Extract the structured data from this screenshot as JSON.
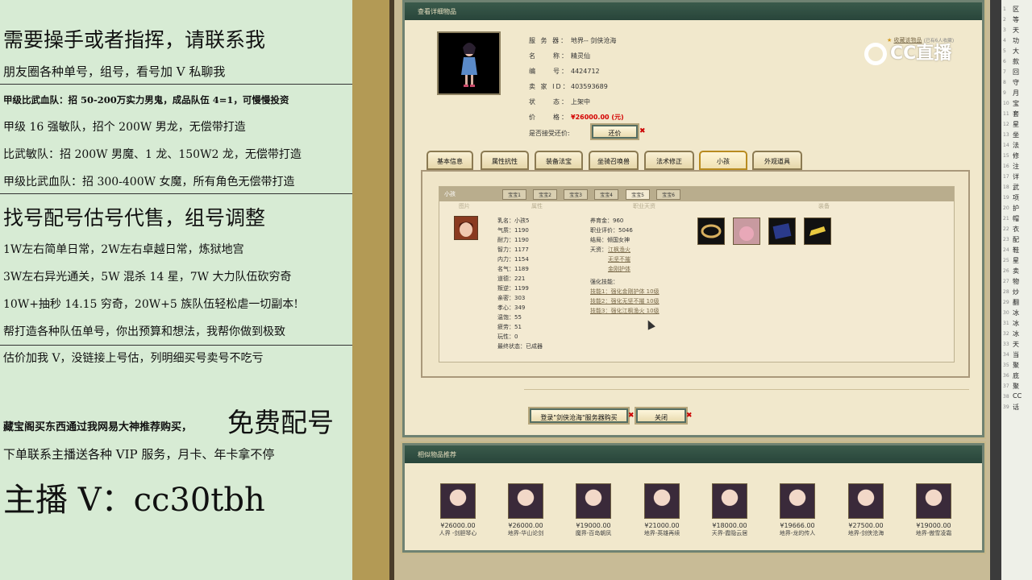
{
  "overlay": {
    "line1": "需要操手或者指挥，请联系我",
    "line2": "朋友圈各种单号，组号，看号加 V 私聊我",
    "line3": "甲级比武血队：招 50-200万实力男鬼，成品队伍 4=1，可慢慢投资",
    "line4": "甲级 16 强敏队，招个 200W 男龙，无偿带打造",
    "line5": "比武敏队：招 200W 男魔、1 龙、150W2 龙，无偿带打造",
    "line6": "甲级比武血队：招 300-400W 女魔，所有角色无偿带打造",
    "line7": "找号配号估号代售，组号调整",
    "line8": "1W左右简单日常，2W左右卓越日常，炼狱地宫",
    "line9": "3W左右异光通关，5W 混杀 14 星，7W 大力队伍砍穷奇",
    "line10": "10W+抽秒 14.15 穷奇，20W+5 族队伍轻松虐一切副本!",
    "line11": "帮打造各种队伍单号，你出预算和想法，我帮你做到极致",
    "line12": "估价加我 V，没链接上号估，列明细买号卖号不吃亏",
    "line13a": "藏宝阁买东西通过我网易大神推荐购买，",
    "line13b": "免费配号",
    "line14": "下单联系主播送各种 VIP 服务，月卡、年卡拿不停",
    "line15": "主播 V：cc30tbh"
  },
  "logo": "CC直播",
  "panel1": {
    "title": "查看详细物品",
    "favorite": "收藏该物品",
    "favorite_count": "(已有6人收藏)",
    "fields": [
      {
        "k": "服 务 器：",
        "v": "地界-- 剑侠沧海"
      },
      {
        "k": "名　　称：",
        "v": "精灵仙"
      },
      {
        "k": "编　　号：",
        "v": "4424712"
      },
      {
        "k": "卖 家 ID：",
        "v": "403593689"
      },
      {
        "k": "状　　态：",
        "v": "上架中"
      },
      {
        "k": "价　　格：",
        "v": "¥26000.00 (元)"
      }
    ],
    "bargain_label": "是否接受还价:",
    "bargain_btn": "还价",
    "tabs": [
      "基本信息",
      "属性抗性",
      "装备法宝",
      "坐骑召唤兽",
      "法术修正",
      "小孩",
      "外观道具"
    ],
    "child": {
      "header": "小孩",
      "subtabs": [
        "宝宝1",
        "宝宝2",
        "宝宝3",
        "宝宝4",
        "宝宝5",
        "宝宝6"
      ],
      "col_pic": "图片",
      "col_attr": "属性",
      "col_skill": "职业天资",
      "col_equip": "装备",
      "attrs": [
        "乳名：小孩5",
        "气质：1190",
        "耐力：1190",
        "智力：1177",
        "内力：1154",
        "名气：1189",
        "道德：221",
        "叛逆：1199",
        "亲密：303",
        "孝心：349",
        "温饱：55",
        "疲劳：51",
        "玩性：0",
        "最终状态：已成器"
      ],
      "skills_top": [
        "养育金：960",
        "职业评价：5046",
        "结局：倾国女神"
      ],
      "talent_label": "天资：",
      "talents": [
        "江枫渔火",
        "无坚不摧",
        "金刚护体"
      ],
      "strengthen_label": "强化技能：",
      "strengthen": [
        "技能1：强化金刚护体 10级",
        "技能2：强化无坚不摧 10级",
        "技能3：强化江枫渔火 10级"
      ]
    },
    "buy_btn": "登录\"剑侠沧海\"服务器购买",
    "close_btn": "关闭"
  },
  "panel2": {
    "title": "相似物品推荐",
    "items": [
      {
        "price": "¥26000.00",
        "server": "人界 -剑胆琴心"
      },
      {
        "price": "¥26000.00",
        "server": "地界-华山论剑"
      },
      {
        "price": "¥19000.00",
        "server": "魔界-百岛朝凤"
      },
      {
        "price": "¥21000.00",
        "server": "地界-英雄再续"
      },
      {
        "price": "¥18000.00",
        "server": "天界-霞隐云居"
      },
      {
        "price": "¥19666.00",
        "server": "地界-龙的传人"
      },
      {
        "price": "¥27500.00",
        "server": "地界-剑侠沧海"
      },
      {
        "price": "¥19000.00",
        "server": "地界-傲雪凌霜"
      }
    ]
  },
  "sidebar": {
    "items": [
      "区",
      "等",
      "天",
      "功",
      "大",
      "款",
      "回",
      "守",
      "月",
      "宝",
      "套",
      "星",
      "坐",
      "法",
      "修",
      "注",
      "详",
      "武",
      "项",
      "护",
      "帽",
      "衣",
      "配",
      "鞋",
      "星",
      "卖",
      "物",
      "炒",
      "翻",
      "冰",
      "冰",
      "冰",
      "天",
      "当",
      "聚",
      "底",
      "聚",
      "CC",
      "话"
    ]
  }
}
